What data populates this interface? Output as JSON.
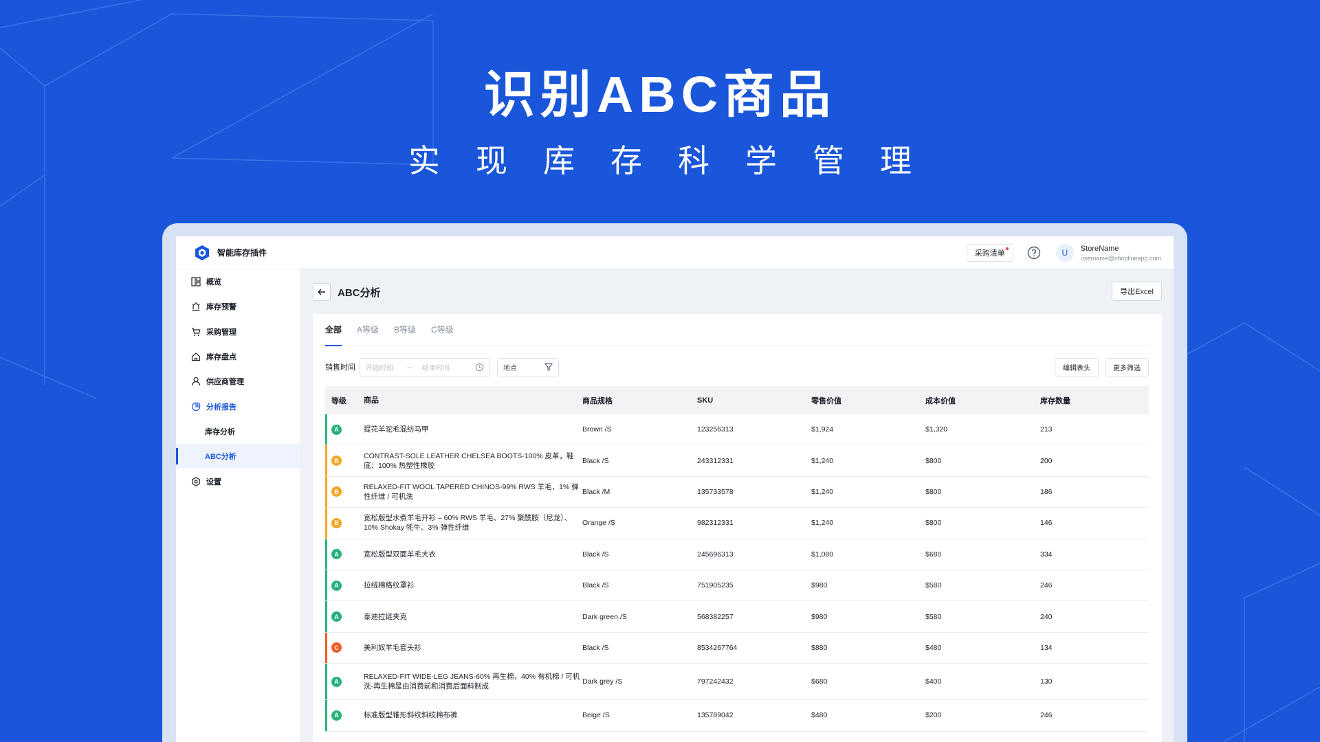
{
  "hero": {
    "title": "识别ABC商品",
    "subtitle": "实现库存科学管理"
  },
  "app": {
    "brand": "智能库存插件",
    "topbar": {
      "cart_label": "采购清单",
      "store_name": "StoreName",
      "email": "username@shoplineapp.com",
      "avatar_letter": "U"
    },
    "sidebar": [
      {
        "label": "概览",
        "icon": "dashboard-icon"
      },
      {
        "label": "库存预警",
        "icon": "alarm-icon"
      },
      {
        "label": "采购管理",
        "icon": "cart-icon"
      },
      {
        "label": "库存盘点",
        "icon": "home-icon"
      },
      {
        "label": "供应商管理",
        "icon": "user-icon"
      },
      {
        "label": "分析报告",
        "icon": "chart-icon"
      },
      {
        "label": "库存分析"
      },
      {
        "label": "ABC分析"
      },
      {
        "label": "设置",
        "icon": "settings-icon"
      }
    ],
    "page": {
      "title": "ABC分析",
      "export_label": "导出Excel"
    },
    "tabs": [
      "全部",
      "A等级",
      "B等级",
      "C等级"
    ],
    "filters": {
      "sales_time_label": "销售时间",
      "start_placeholder": "开始时间",
      "end_placeholder": "结束时间",
      "location_label": "地点",
      "edit_header_label": "编辑表头",
      "more_filters_label": "更多筛选"
    },
    "table": {
      "headers": [
        "等级",
        "商品",
        "商品规格",
        "SKU",
        "零售价值",
        "成本价值",
        "库存数量"
      ],
      "rows": [
        {
          "grade": "A",
          "name": "提花羊驼毛混纺马甲",
          "spec": "Brown /S",
          "sku": "123256313",
          "retail": "$1,924",
          "cost": "$1,320",
          "qty": "213"
        },
        {
          "grade": "B",
          "name": "CONTRAST-SOLE LEATHER CHELSEA BOOTS-100% 皮革，鞋底：100% 热塑性橡胶",
          "spec": "Black /S",
          "sku": "243312331",
          "retail": "$1,240",
          "cost": "$800",
          "qty": "200"
        },
        {
          "grade": "B",
          "name": "RELAXED-FIT WOOL TAPERED CHINOS-99% RWS 羊毛，1% 弹性纤维 / 可机洗",
          "spec": "Black /M",
          "sku": "135733578",
          "retail": "$1,240",
          "cost": "$800",
          "qty": "186"
        },
        {
          "grade": "B",
          "name": "宽松版型水煮羊毛开衫 – 60% RWS 羊毛、27% 聚酰胺（尼龙）、10% Shokay 牦牛、3% 弹性纤维",
          "spec": "Orange /S",
          "sku": "982312331",
          "retail": "$1,240",
          "cost": "$800",
          "qty": "146"
        },
        {
          "grade": "A",
          "name": "宽松版型双面羊毛大衣",
          "spec": "Black /S",
          "sku": "245696313",
          "retail": "$1,080",
          "cost": "$680",
          "qty": "334"
        },
        {
          "grade": "A",
          "name": "拉绒棉格纹罩衫",
          "spec": "Black /S",
          "sku": "751905235",
          "retail": "$980",
          "cost": "$580",
          "qty": "246"
        },
        {
          "grade": "A",
          "name": "泰迪拉链夹克",
          "spec": "Dark green /S",
          "sku": "568382257",
          "retail": "$980",
          "cost": "$580",
          "qty": "240"
        },
        {
          "grade": "C",
          "name": "美利奴羊毛套头衫",
          "spec": "Black /S",
          "sku": "8534267764",
          "retail": "$880",
          "cost": "$480",
          "qty": "134"
        },
        {
          "grade": "A",
          "name": "RELAXED-FIT WIDE-LEG JEANS-60% 再生棉，40% 有机棉 / 可机洗-再生棉是由消费前和消费后面料制成",
          "spec": "Dark grey /S",
          "sku": "797242432",
          "retail": "$680",
          "cost": "$400",
          "qty": "130"
        },
        {
          "grade": "A",
          "name": "标准版型锥形斜纹斜纹棉布裤",
          "spec": "Beige /S",
          "sku": "135789042",
          "retail": "$480",
          "cost": "$200",
          "qty": "246"
        }
      ]
    },
    "grade_colors": {
      "A": "#27b17a",
      "B": "#f5a623",
      "C": "#f05a28"
    },
    "accent": "#1a56d9"
  }
}
